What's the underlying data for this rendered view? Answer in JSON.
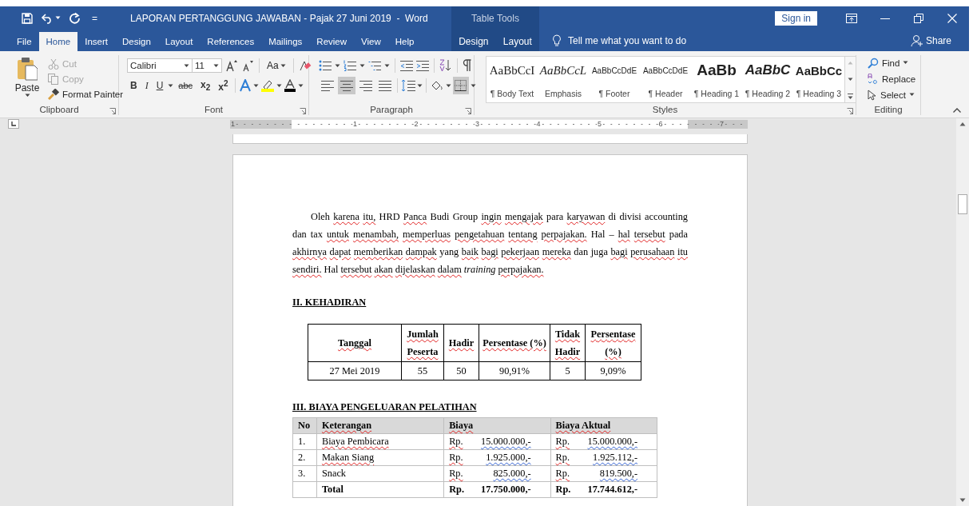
{
  "window": {
    "title": "LAPORAN PERTANGGUNG JAWABAN - Pajak 27 Juni 2019  -  Word",
    "contextual_group": "Table Tools",
    "sign_in": "Sign in",
    "customize_mark": "="
  },
  "ribbon_tabs": [
    {
      "label": "File",
      "selected": false,
      "kind": "normal"
    },
    {
      "label": "Home",
      "selected": true,
      "kind": "normal"
    },
    {
      "label": "Insert",
      "selected": false,
      "kind": "normal"
    },
    {
      "label": "Design",
      "selected": false,
      "kind": "normal"
    },
    {
      "label": "Layout",
      "selected": false,
      "kind": "normal"
    },
    {
      "label": "References",
      "selected": false,
      "kind": "normal"
    },
    {
      "label": "Mailings",
      "selected": false,
      "kind": "normal"
    },
    {
      "label": "Review",
      "selected": false,
      "kind": "normal"
    },
    {
      "label": "View",
      "selected": false,
      "kind": "normal"
    },
    {
      "label": "Help",
      "selected": false,
      "kind": "normal"
    },
    {
      "label": "Design",
      "selected": false,
      "kind": "contextual"
    },
    {
      "label": "Layout",
      "selected": false,
      "kind": "contextual"
    }
  ],
  "tell_me": "Tell me what you want to do",
  "share": "Share",
  "clipboard": {
    "label": "Clipboard",
    "paste": "Paste",
    "commands": [
      {
        "label": "Cut",
        "disabled": true,
        "kind": "cut"
      },
      {
        "label": "Copy",
        "disabled": true,
        "kind": "copy"
      },
      {
        "label": "Format Painter",
        "disabled": false,
        "kind": "painter"
      }
    ]
  },
  "font": {
    "label": "Font",
    "name": "Calibri",
    "size": "11",
    "change_case": "Aa",
    "format_buttons": [
      {
        "text": "B",
        "kind": "bold"
      },
      {
        "text": "I",
        "kind": "italic"
      },
      {
        "text": "U",
        "kind": "underline"
      },
      {
        "text": "abc",
        "kind": "strike"
      },
      {
        "text": "x$_{2}$",
        "kind": "script"
      },
      {
        "text": "x$^{2}$",
        "kind": "script"
      }
    ]
  },
  "paragraph": {
    "label": "Paragraph",
    "alignment": [
      {
        "selected": false
      },
      {
        "selected": true
      },
      {
        "selected": false
      },
      {
        "selected": false
      }
    ],
    "borders_selected": true
  },
  "styles": {
    "label": "Styles",
    "items": [
      {
        "preview": "AaBbCcI",
        "name": "¶ Body Text",
        "kind": "body"
      },
      {
        "preview": "AaBbCcL",
        "name": "Emphasis",
        "kind": "emphasis"
      },
      {
        "preview": "AaBbCcDdE",
        "name": "¶ Footer",
        "kind": "small"
      },
      {
        "preview": "AaBbCcDdE",
        "name": "¶ Header",
        "kind": "small"
      },
      {
        "preview": "AaBb",
        "name": "¶ Heading 1",
        "kind": "heading1"
      },
      {
        "preview": "AaBbC",
        "name": "¶ Heading 2",
        "kind": "heading2"
      },
      {
        "preview": "AaBbCc",
        "name": "¶ Heading 3",
        "kind": "heading3"
      }
    ]
  },
  "editing": {
    "label": "Editing",
    "find": "Find",
    "replace": "Replace",
    "select": "Select"
  },
  "ruler_numbers": [
    "1",
    "1",
    "2",
    "3",
    "4",
    "5",
    "6",
    "7"
  ],
  "document": {
    "paragraph": [
      {
        "text": "Oleh "
      },
      {
        "text": "karena",
        "misspelled": true
      },
      {
        "text": " itu,",
        "misspelled": true
      },
      {
        "text": " HRD "
      },
      {
        "text": "Panca",
        "misspelled": true
      },
      {
        "text": " Budi Group "
      },
      {
        "text": "ingin",
        "misspelled": true
      },
      {
        "text": " mengajak",
        "misspelled": true
      },
      {
        "text": " para "
      },
      {
        "text": "karyawan",
        "misspelled": true
      },
      {
        "text": " di divisi accounting dan tax "
      },
      {
        "text": "untuk",
        "misspelled": true
      },
      {
        "text": " menambah,",
        "misspelled": true
      },
      {
        "text": " memperluas",
        "misspelled": true
      },
      {
        "text": " pengetahuan",
        "misspelled": true
      },
      {
        "text": " tentang",
        "misspelled": true
      },
      {
        "text": " perpajakan.",
        "misspelled": true
      },
      {
        "text": " Hal – "
      },
      {
        "text": "hal",
        "misspelled": true
      },
      {
        "text": " tersebut",
        "misspelled": true
      },
      {
        "text": " pada "
      },
      {
        "text": "akhirnya",
        "misspelled": true
      },
      {
        "text": " dapat",
        "misspelled": true
      },
      {
        "text": " memberikan",
        "misspelled": true
      },
      {
        "text": " dampak",
        "misspelled": true
      },
      {
        "text": " yang "
      },
      {
        "text": "baik",
        "misspelled": true
      },
      {
        "text": " bagi",
        "misspelled": true
      },
      {
        "text": " pekerjaan",
        "misspelled": true
      },
      {
        "text": " mereka",
        "misspelled": true
      },
      {
        "text": " dan juga "
      },
      {
        "text": "bagi",
        "misspelled": true
      },
      {
        "text": " perusahaan",
        "misspelled": true
      },
      {
        "text": " itu",
        "misspelled": true
      },
      {
        "text": " sendiri.",
        "misspelled": true
      },
      {
        "text": " Hal "
      },
      {
        "text": "tersebut",
        "misspelled": true
      },
      {
        "text": " akan",
        "misspelled": true
      },
      {
        "text": " dijelaskan",
        "misspelled": true
      },
      {
        "text": " dalam",
        "misspelled": true
      },
      {
        "text": " *training* "
      },
      {
        "text": "perpajakan.",
        "misspelled": true
      }
    ],
    "attendance_heading": "II. KEHADIRAN",
    "attendance_table": {
      "columns": [
        {
          "label": "Tanggal",
          "misspelled": true
        },
        {
          "label": "Jumlah Peserta",
          "misspelled": true
        },
        {
          "label": "Hadir",
          "misspelled": true
        },
        {
          "label": "Persentase (%)",
          "misspelled": true
        },
        {
          "label": "Tidak Hadir",
          "misspelled": true
        },
        {
          "label": "Persentase (%)",
          "misspelled": true
        }
      ],
      "rows": [
        [
          "27 Mei 2019",
          "55",
          "50",
          "90,91%",
          "5",
          "9,09%"
        ]
      ]
    },
    "cost_heading": "III. BIAYA PENGELUARAN PELATIHAN",
    "cost_table": {
      "columns": [
        {
          "label": "No",
          "misspelled": false
        },
        {
          "label": "Keterangan",
          "misspelled": true
        },
        {
          "label": "Biaya",
          "misspelled": true
        },
        {
          "label": "Biaya Aktual",
          "misspelled": true
        }
      ],
      "rows": [
        {
          "kind": "item",
          "no": "1.",
          "description": "Biaya Pembicara",
          "misspelled": true,
          "cost": {
            "currency": "Rp.",
            "amount": "15.000.000,-"
          },
          "actual": {
            "currency": "Rp.",
            "amount": "15.000.000,-"
          }
        },
        {
          "kind": "item",
          "no": "2.",
          "description": "Makan Siang",
          "misspelled": true,
          "cost": {
            "currency": "Rp.",
            "amount": "1.925.000,-"
          },
          "actual": {
            "currency": "Rp.",
            "amount": "1.925.112,-"
          }
        },
        {
          "kind": "item",
          "no": "3.",
          "description": "Snack",
          "misspelled": false,
          "cost": {
            "currency": "Rp.",
            "amount": "825.000,-"
          },
          "actual": {
            "currency": "Rp.",
            "amount": "819.500,-"
          }
        },
        {
          "kind": "total",
          "description": "Total",
          "misspelled": false,
          "cost": {
            "currency": "Rp.",
            "amount": "17.750.000,-"
          },
          "actual": {
            "currency": "Rp.",
            "amount": "17.744.612,-"
          }
        }
      ]
    }
  }
}
